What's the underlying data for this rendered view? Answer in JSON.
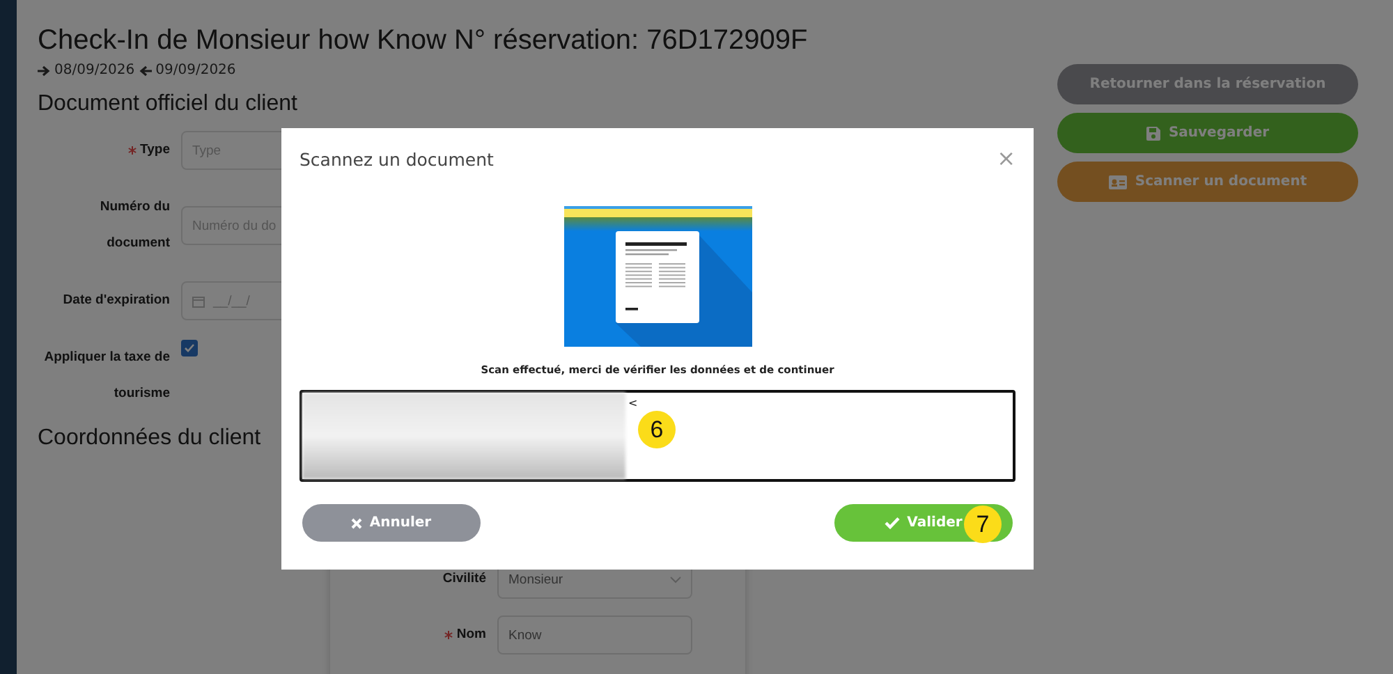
{
  "header": {
    "title": "Check-In de Monsieur how Know N° réservation: 76D172909F",
    "arrival": "08/09/2026",
    "departure": "09/09/2026"
  },
  "document_section": {
    "heading": "Document officiel du client",
    "fields": [
      {
        "kind": "input",
        "label": "Type",
        "required": true,
        "placeholder": "Type"
      },
      {
        "kind": "input",
        "label": "Numéro du document",
        "required": false,
        "placeholder": "Numéro du do"
      },
      {
        "kind": "date",
        "label": "Date d'expiration",
        "required": false,
        "placeholder": "__/__/"
      },
      {
        "kind": "checkbox",
        "label": "Appliquer la taxe de tourisme",
        "required": false,
        "checked": true
      }
    ]
  },
  "client_section": {
    "heading": "Coordonnées du client",
    "fields": [
      {
        "kind": "select",
        "label": "Civilité",
        "required": false,
        "value": "Monsieur"
      },
      {
        "kind": "input",
        "label": "Nom",
        "required": true,
        "value": "Know"
      }
    ]
  },
  "actions": [
    {
      "kind": "back",
      "label": "Retourner dans la réservation"
    },
    {
      "kind": "save",
      "label": "Sauvegarder"
    },
    {
      "kind": "scan",
      "label": "Scanner un document"
    }
  ],
  "modal": {
    "title": "Scannez un document",
    "close": "×",
    "message": "Scan effectué, merci de vérifier les données et de continuer",
    "scan_text": "<",
    "buttons": [
      {
        "kind": "cancel",
        "label": "Annuler"
      },
      {
        "kind": "confirm",
        "label": "Valider"
      }
    ]
  },
  "markers": [
    {
      "label": "6"
    },
    {
      "label": "7"
    }
  ]
}
